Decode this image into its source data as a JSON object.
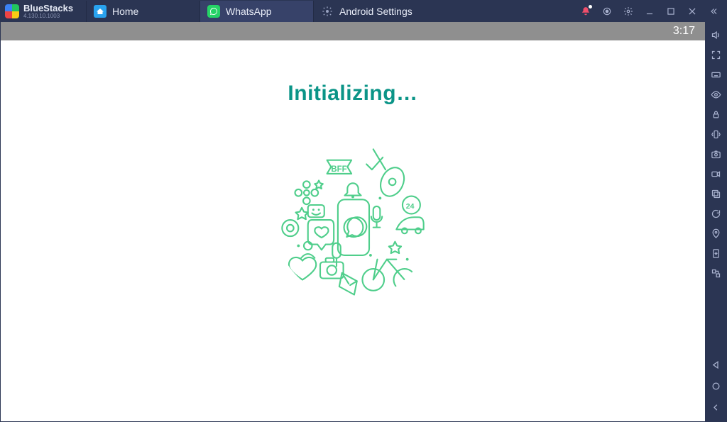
{
  "brand": {
    "name": "BlueStacks",
    "version": "4.130.10.1003"
  },
  "tabs": [
    {
      "label": "Home",
      "icon": "home-icon",
      "active": false
    },
    {
      "label": "WhatsApp",
      "icon": "whatsapp-icon",
      "active": true
    },
    {
      "label": "Android Settings",
      "icon": "gear-icon",
      "active": false
    }
  ],
  "titlebar_icons": [
    "bell-icon",
    "record-icon",
    "gear-icon",
    "minimize-icon",
    "maximize-icon",
    "close-icon",
    "collapse-icon"
  ],
  "statusbar": {
    "clock": "3:17"
  },
  "main": {
    "heading": "Initializing…",
    "illustration": "whatsapp-doodle-circle"
  },
  "right_rail": [
    "volume-icon",
    "fullscreen-icon",
    "keyboard-icon",
    "eye-icon",
    "lock-rotate-icon",
    "shake-icon",
    "camera-icon",
    "video-icon",
    "copy-icon",
    "rotate-icon",
    "pin-icon",
    "apk-icon",
    "share-icon"
  ],
  "right_rail_bottom": [
    "back-circle-icon",
    "home-circle-icon",
    "chevron-left-icon"
  ],
  "colors": {
    "teal": "#0a9487",
    "whatsapp_green": "#25d366",
    "doodle_green": "#4fce8b",
    "chrome_dark": "#2b3553",
    "chrome_active": "#374269",
    "bell_red": "#ef4f6b"
  }
}
